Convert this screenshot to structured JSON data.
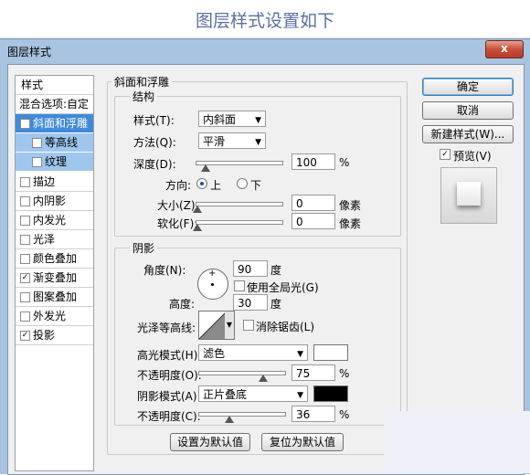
{
  "tutorial_heading": "图层样式设置如下",
  "window": {
    "title": "图层样式",
    "close_label": "x"
  },
  "styles_panel": {
    "header": "样式",
    "blend_options": "混合选项:自定",
    "items": [
      {
        "label": "斜面和浮雕",
        "checked": true,
        "check": "✓"
      },
      {
        "label": "等高线",
        "checked": false,
        "check": ""
      },
      {
        "label": "纹理",
        "checked": false,
        "check": ""
      },
      {
        "label": "描边",
        "checked": false,
        "check": ""
      },
      {
        "label": "内阴影",
        "checked": false,
        "check": ""
      },
      {
        "label": "内发光",
        "checked": false,
        "check": ""
      },
      {
        "label": "光泽",
        "checked": false,
        "check": ""
      },
      {
        "label": "颜色叠加",
        "checked": false,
        "check": ""
      },
      {
        "label": "渐变叠加",
        "checked": true,
        "check": "✓"
      },
      {
        "label": "图案叠加",
        "checked": false,
        "check": ""
      },
      {
        "label": "外发光",
        "checked": false,
        "check": ""
      },
      {
        "label": "投影",
        "checked": true,
        "check": "✓"
      }
    ]
  },
  "bevel": {
    "title": "斜面和浮雕",
    "structure_title": "结构",
    "style_label": "样式(T):",
    "style_value": "内斜面",
    "technique_label": "方法(Q):",
    "technique_value": "平滑",
    "depth_label": "深度(D):",
    "depth_value": "100",
    "depth_unit": "%",
    "depth_level": 0.1,
    "direction_label": "方向:",
    "direction_up": "上",
    "direction_down": "下",
    "size_label": "大小(Z):",
    "size_value": "0",
    "size_unit": "像素",
    "soften_label": "软化(F):",
    "soften_value": "0",
    "soften_unit": "像素"
  },
  "shading": {
    "title": "阴影",
    "angle_label": "角度(N):",
    "angle_value": "90",
    "angle_unit": "度",
    "global_light_label": "使用全局光(G)",
    "altitude_label": "高度:",
    "altitude_value": "30",
    "altitude_unit": "度",
    "gloss_contour_label": "光泽等高线:",
    "anti_alias_label": "消除锯齿(L)",
    "highlight_mode_label": "高光模式(H):",
    "highlight_mode_value": "滤色",
    "highlight_color": "#ffffff",
    "highlight_opacity_label": "不透明度(O):",
    "highlight_opacity_value": "75",
    "highlight_opacity_unit": "%",
    "highlight_opacity_level": 0.75,
    "shadow_mode_label": "阴影模式(A):",
    "shadow_mode_value": "正片叠底",
    "shadow_color": "#000000",
    "shadow_opacity_label": "不透明度(C):",
    "shadow_opacity_value": "36",
    "shadow_opacity_unit": "%",
    "shadow_opacity_level": 0.36
  },
  "bottom_buttons": {
    "make_default": "设置为默认值",
    "reset_default": "复位为默认值"
  },
  "right_buttons": {
    "ok": "确定",
    "cancel": "取消",
    "new_style": "新建样式(W)...",
    "preview": "预览(V)"
  },
  "colors": {
    "accent": "#3f8ad9",
    "title_text": "#5b6fa6"
  }
}
